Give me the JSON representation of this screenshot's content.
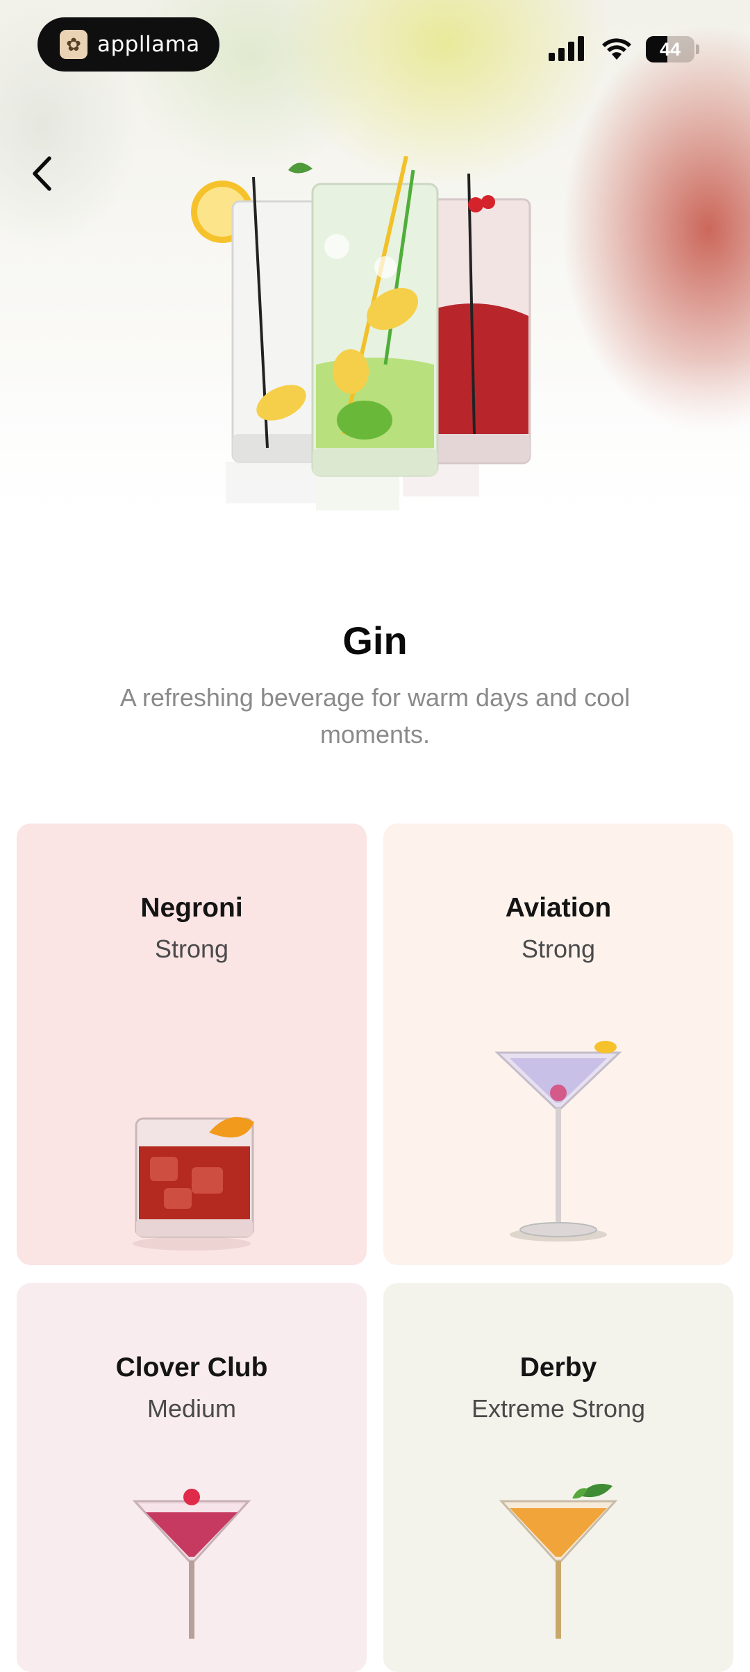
{
  "status_bar": {
    "app_name": "appllama",
    "app_logo_icon": "llama-logo-icon",
    "battery_level": "44",
    "battery_fraction": 0.44,
    "signal_icon": "cellular-signal-icon",
    "wifi_icon": "wifi-icon"
  },
  "navigation": {
    "back_icon": "chevron-left-icon"
  },
  "hero": {
    "image": "gin-cocktails-hero-image"
  },
  "header": {
    "title": "Gin",
    "subtitle": "A refreshing beverage for warm days and cool moments."
  },
  "cocktails": [
    {
      "name": "Negroni",
      "strength": "Strong",
      "background": "#fbe4e4",
      "image": "negroni-rocks-glass-image"
    },
    {
      "name": "Aviation",
      "strength": "Strong",
      "background": "#fdf3ec",
      "image": "aviation-martini-glass-image"
    },
    {
      "name": "Clover Club",
      "strength": "Medium",
      "background": "#f8ecee",
      "image": "clover-club-martini-glass-image"
    },
    {
      "name": "Derby",
      "strength": "Extreme Strong",
      "background": "#f3f3ec",
      "image": "derby-martini-glass-image"
    }
  ]
}
